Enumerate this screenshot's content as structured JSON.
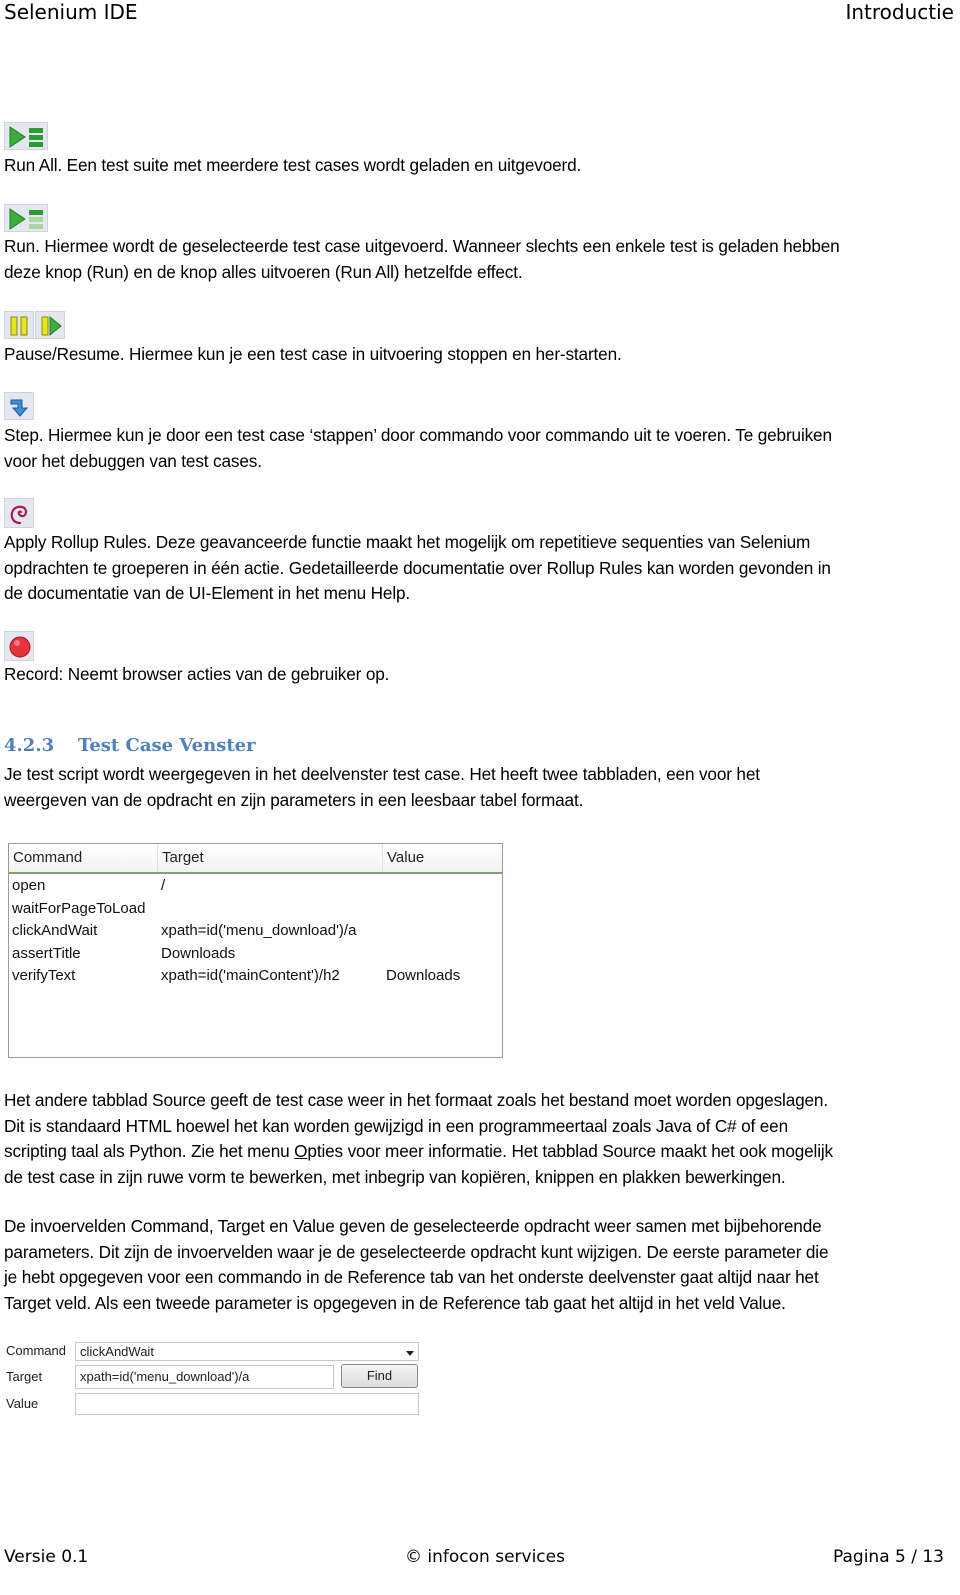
{
  "header": {
    "left": "Selenium IDE",
    "right": "Introductie"
  },
  "toolbar_descriptions": [
    {
      "icon": "run-all-icon",
      "text": "Run All. Een test suite met meerdere test cases wordt geladen en uitgevoerd."
    },
    {
      "icon": "run-icon",
      "text_line1": "Run. Hiermee wordt de geselecteerde test case uitgevoerd. Wanneer slechts een enkele test is geladen hebben",
      "text_line2": "deze knop (Run) en de knop alles uitvoeren (Run All) hetzelfde effect."
    },
    {
      "icon": "pause-resume-icon",
      "text": "Pause/Resume. Hiermee kun je een test case in uitvoering stoppen en her-starten."
    },
    {
      "icon": "step-icon",
      "text_line1": "Step. Hiermee kun je door een test case ‘stappen’ door commando voor commando uit te voeren. Te gebruiken",
      "text_line2": "voor het debuggen van test cases."
    },
    {
      "icon": "rollup-icon",
      "text_line1": "Apply Rollup Rules. Deze geavanceerde functie maakt het mogelijk om repetitieve sequenties van Selenium",
      "text_line2": "opdrachten te groeperen in één actie. Gedetailleerde documentatie over Rollup Rules kan worden gevonden in",
      "text_line3": "de documentatie van de UI-Element in het menu Help."
    },
    {
      "icon": "record-icon",
      "text": "Record: Neemt browser acties van de gebruiker op."
    }
  ],
  "section": {
    "number": "4.2.3",
    "title": "Test Case Venster",
    "intro_line1": "Je test script wordt weergegeven in het deelvenster test case. Het heeft twee tabbladen, een voor het",
    "intro_line2": "weergeven van de opdracht en zijn parameters in een leesbaar tabel formaat."
  },
  "testcase_table": {
    "headers": [
      "Command",
      "Target",
      "Value"
    ],
    "rows": [
      [
        "open",
        "/",
        ""
      ],
      [
        "waitForPageToLoad",
        "",
        ""
      ],
      [
        "clickAndWait",
        "xpath=id('menu_download')/a",
        ""
      ],
      [
        "assertTitle",
        "Downloads",
        ""
      ],
      [
        "verifyText",
        "xpath=id('mainContent')/h2",
        "Downloads"
      ]
    ]
  },
  "source_paragraph": {
    "line1": "Het andere tabblad Source  geeft de test case weer in het formaat zoals het bestand moet worden opgeslagen.",
    "line2": "Dit is standaard HTML hoewel het kan worden gewijzigd in een programmeertaal zoals Java of C# of een",
    "line3_pre": "scripting taal als Python. Zie het menu ",
    "line3_u": "O",
    "line3_mid": "pties",
    "line3_post": " voor meer informatie. Het tabblad Source maakt het ook mogelijk",
    "line4": "de test case in zijn ruwe vorm te bewerken, met inbegrip van kopiëren,  knippen en plakken bewerkingen."
  },
  "fields_paragraph": {
    "line1": "De invoervelden Command, Target en Value geven de geselecteerde opdracht weer samen met bijbehorende",
    "line2": "parameters. Dit zijn de invoervelden waar je de geselecteerde opdracht kunt wijzigen. De eerste parameter die",
    "line3": "je hebt opgegeven voor een commando in de Reference tab van het onderste deelvenster gaat altijd naar het",
    "line4": "Target veld. Als een tweede parameter is opgegeven in de Reference tab gaat het altijd in het veld Value."
  },
  "command_form": {
    "command_label": "Command",
    "command_value": "clickAndWait",
    "target_label": "Target",
    "target_value": "xpath=id('menu_download')/a",
    "find_button": "Find",
    "value_label": "Value",
    "value_value": ""
  },
  "footer": {
    "left": "Versie 0.1",
    "center": "© infocon services",
    "right": "Pagina 5 / 13"
  }
}
